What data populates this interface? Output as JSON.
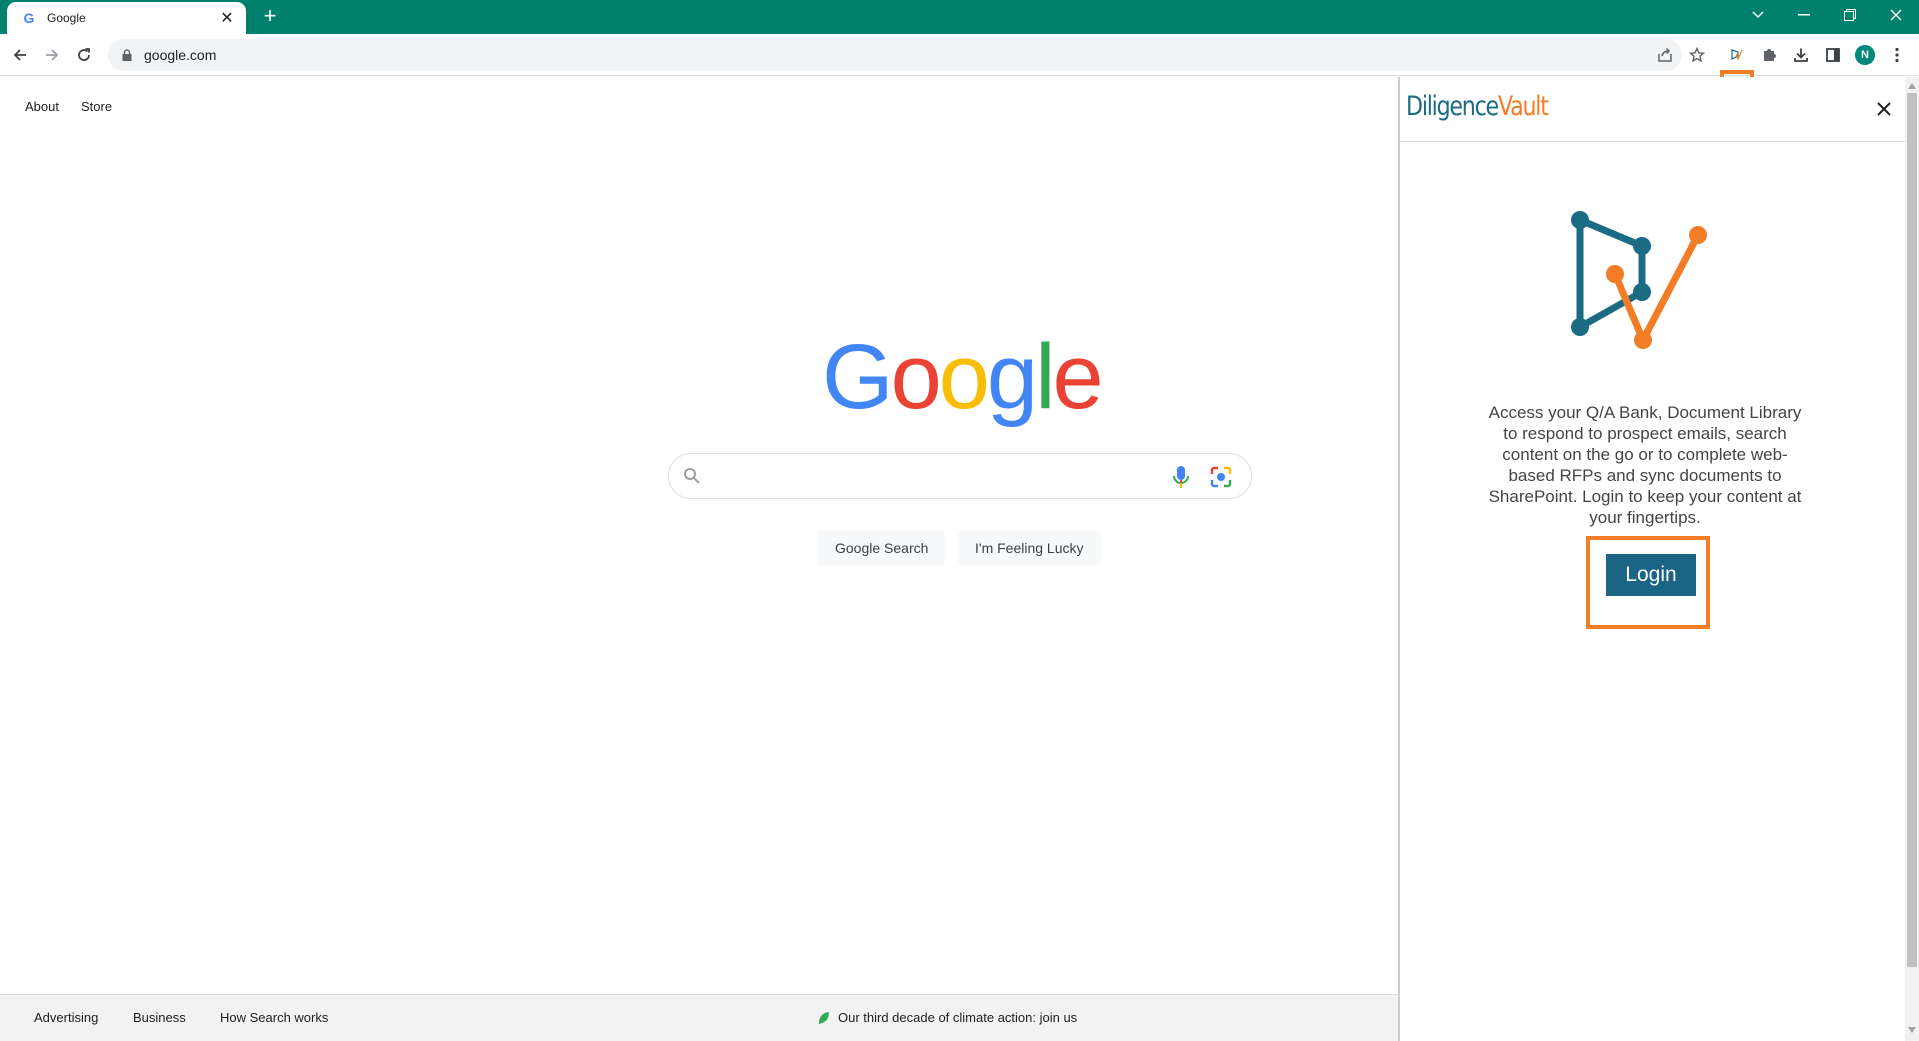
{
  "browser": {
    "tab": {
      "title": "Google",
      "favicon": "google-g-icon"
    },
    "address": "google.com",
    "avatar_initial": "N",
    "colors": {
      "tabstrip": "#00806f",
      "highlight": "#f27d26"
    }
  },
  "google": {
    "top_links": [
      "About",
      "Store"
    ],
    "logo_letters": [
      {
        "char": "G",
        "color": "#4285f4"
      },
      {
        "char": "o",
        "color": "#ea4335"
      },
      {
        "char": "o",
        "color": "#fbbc05"
      },
      {
        "char": "g",
        "color": "#4285f4"
      },
      {
        "char": "l",
        "color": "#34a853"
      },
      {
        "char": "e",
        "color": "#ea4335"
      }
    ],
    "search_value": "",
    "buttons": {
      "search": "Google Search",
      "lucky": "I'm Feeling Lucky"
    },
    "footer": {
      "links": [
        "Advertising",
        "Business",
        "How Search works"
      ],
      "climate": "Our third decade of climate action: join us"
    }
  },
  "panel": {
    "brand_part1": "Diligence",
    "brand_part2": "Vault",
    "description": "Access your Q/A Bank, Document Library to respond to prospect emails, search content on the go or to complete web-based RFPs and sync documents to SharePoint. Login to keep your content at your fingertips.",
    "login_label": "Login",
    "colors": {
      "teal": "#1c6b84",
      "orange": "#f27d26",
      "button": "#1a6485"
    }
  }
}
